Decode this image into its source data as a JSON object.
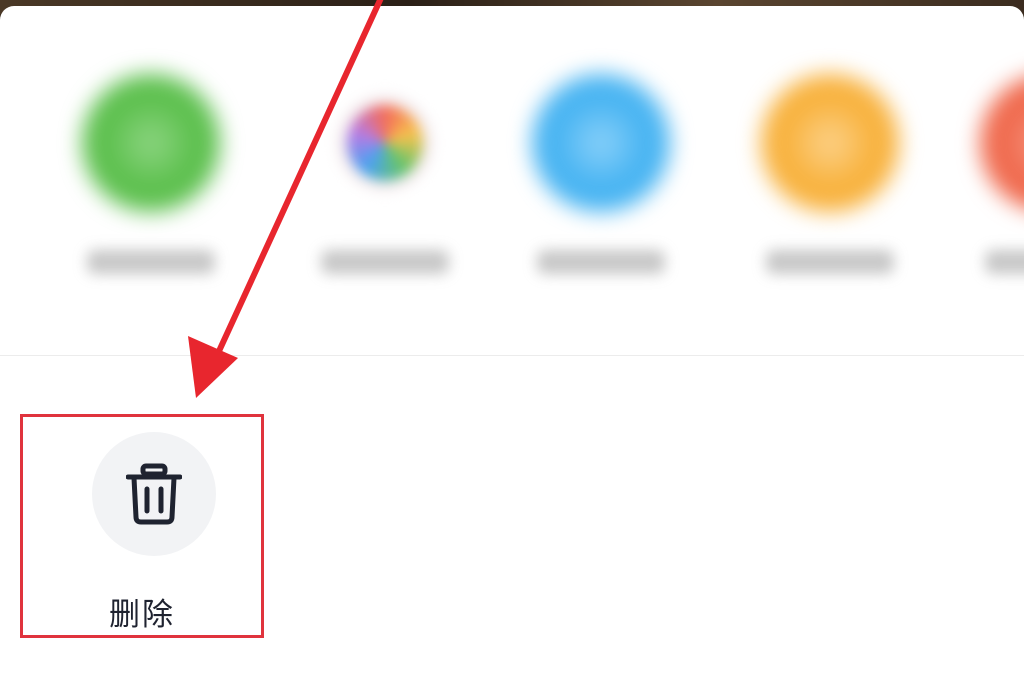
{
  "share_sheet": {
    "apps": [
      {
        "label": "",
        "color": "#5dc04e",
        "inner_color": "#8fd684",
        "icon": "green-share-app-icon"
      },
      {
        "label": "",
        "color": "#f4ecee",
        "inner_color": "#e4c6a2",
        "icon": "multicolor-share-app-icon"
      },
      {
        "label": "",
        "color": "#48b4f2",
        "inner_color": "#8dd2fa",
        "icon": "blue-share-app-icon"
      },
      {
        "label": "",
        "color": "#f8b23e",
        "inner_color": "#fcd38d",
        "icon": "orange-share-app-icon"
      },
      {
        "label": "",
        "color": "#f06a4e",
        "inner_color": "#f6a08c",
        "icon": "red-share-app-icon"
      }
    ]
  },
  "actions": {
    "delete": {
      "label": "删除",
      "icon": "trash-icon"
    }
  },
  "annotation": {
    "highlight_color": "#e0333d",
    "arrow_color": "#e8262e"
  }
}
